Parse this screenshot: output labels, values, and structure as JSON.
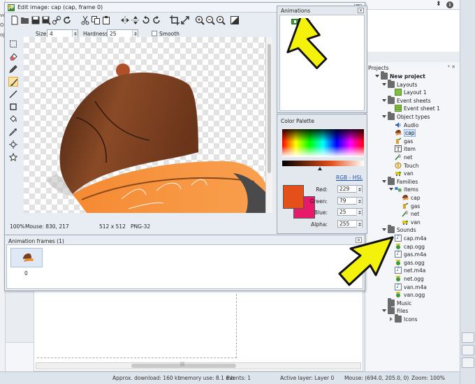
{
  "edit_window": {
    "title": "Edit image: cap (cap, frame 0)",
    "close_label": "⊠"
  },
  "options": {
    "size_label": "Size",
    "size_value": "4",
    "hardness_label": "Hardness",
    "hardness_value": "25",
    "smooth_label": "Smooth"
  },
  "canvas_info": {
    "zoom": "100%",
    "mouse": "Mouse: 830, 217",
    "dimensions": "512 x 512",
    "format": "PNG-32"
  },
  "animations": {
    "header": "Animations",
    "items": [
      "cap"
    ]
  },
  "color_palette": {
    "header": "Color Palette",
    "mode_link": "RGB - HSL",
    "primary_color": "#e5501a",
    "secondary_color": "#e8186a",
    "red_label": "Red:",
    "red_value": "229",
    "green_label": "Green:",
    "green_value": "79",
    "blue_label": "Blue:",
    "blue_value": "25",
    "alpha_label": "Alpha:",
    "alpha_value": "255"
  },
  "animation_frames": {
    "header": "Animation frames (1)",
    "frames": [
      "0"
    ]
  },
  "projects": {
    "header": "Projects",
    "header_buttons": "ᵠ ✕",
    "tree": [
      {
        "label": "New project",
        "level": 0,
        "kind": "folder",
        "expanded": true,
        "bold": true
      },
      {
        "label": "Layouts",
        "level": 1,
        "kind": "folder",
        "expanded": true
      },
      {
        "label": "Layout 1",
        "level": 2,
        "kind": "layout"
      },
      {
        "label": "Event sheets",
        "level": 1,
        "kind": "folder",
        "expanded": true
      },
      {
        "label": "Event sheet 1",
        "level": 2,
        "kind": "sheet"
      },
      {
        "label": "Object types",
        "level": 1,
        "kind": "folder",
        "expanded": true
      },
      {
        "label": "Audio",
        "level": 2,
        "kind": "audio"
      },
      {
        "label": "cap",
        "level": 2,
        "kind": "cap",
        "selected": true
      },
      {
        "label": "gas",
        "level": 2,
        "kind": "gas"
      },
      {
        "label": "item",
        "level": 2,
        "kind": "text"
      },
      {
        "label": "net",
        "level": 2,
        "kind": "net"
      },
      {
        "label": "Touch",
        "level": 2,
        "kind": "touch"
      },
      {
        "label": "van",
        "level": 2,
        "kind": "van"
      },
      {
        "label": "Families",
        "level": 1,
        "kind": "folder",
        "expanded": true
      },
      {
        "label": "items",
        "level": 2,
        "kind": "family",
        "expanded": true
      },
      {
        "label": "cap",
        "level": 3,
        "kind": "cap"
      },
      {
        "label": "gas",
        "level": 3,
        "kind": "gas"
      },
      {
        "label": "net",
        "level": 3,
        "kind": "net"
      },
      {
        "label": "van",
        "level": 3,
        "kind": "van"
      },
      {
        "label": "Sounds",
        "level": 1,
        "kind": "folder",
        "expanded": true
      },
      {
        "label": "cap.m4a",
        "level": 2,
        "kind": "sound"
      },
      {
        "label": "cap.ogg",
        "level": 2,
        "kind": "ogg"
      },
      {
        "label": "gas.m4a",
        "level": 2,
        "kind": "sound"
      },
      {
        "label": "gas.ogg",
        "level": 2,
        "kind": "ogg"
      },
      {
        "label": "net.m4a",
        "level": 2,
        "kind": "sound"
      },
      {
        "label": "net.ogg",
        "level": 2,
        "kind": "ogg"
      },
      {
        "label": "van.m4a",
        "level": 2,
        "kind": "sound"
      },
      {
        "label": "van.ogg",
        "level": 2,
        "kind": "ogg"
      },
      {
        "label": "Music",
        "level": 1,
        "kind": "folder"
      },
      {
        "label": "Files",
        "level": 1,
        "kind": "folder",
        "expanded": true
      },
      {
        "label": "Icons",
        "level": 2,
        "kind": "folder",
        "collapsed": true
      }
    ]
  },
  "status_bar": {
    "download": "Approx. download: 160 kb",
    "memory": "memory use: 8.1 mb",
    "events": "Events: 1",
    "active_layer": "Active layer: Layer 0",
    "mouse": "Mouse: (694.0, 205.0, 0)",
    "zoom": "Zoom: 100%"
  },
  "background": {
    "left_fragments": [
      "ve",
      "Or",
      "oje"
    ],
    "top_right_glyphs": [
      "⬍",
      "ℹ"
    ]
  },
  "colors": {
    "cap_brown": "#7a4020",
    "cap_orange": "#f08a2e",
    "arrow_yellow": "#f4f20a"
  }
}
